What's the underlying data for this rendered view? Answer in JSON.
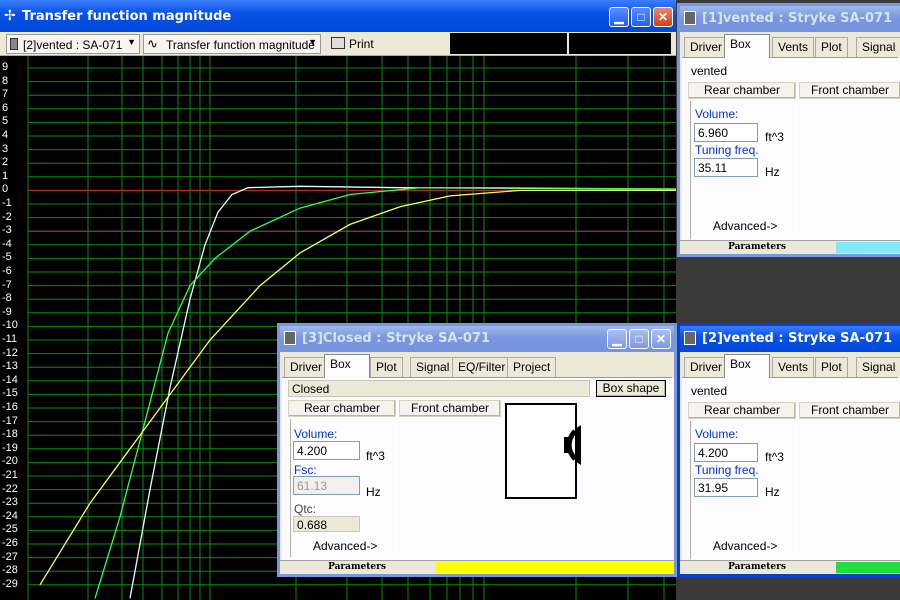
{
  "main_window": {
    "title": "Transfer function magnitude",
    "toolbar": {
      "driver_select": "[2]vented : SA-071",
      "view_select": "Transfer function magnitude",
      "print_label": "Print"
    },
    "y_axis_labels": [
      "9",
      "8",
      "7",
      "6",
      "5",
      "4",
      "3",
      "2",
      "1",
      "0",
      "-1",
      "-2",
      "-3",
      "-4",
      "-5",
      "-6",
      "-7",
      "-8",
      "-9",
      "-10",
      "-11",
      "-12",
      "-13",
      "-14",
      "-15",
      "-16",
      "-17",
      "-18",
      "-19",
      "-20",
      "-21",
      "-22",
      "-23",
      "-24",
      "-25",
      "-26",
      "-27",
      "-28",
      "-29"
    ]
  },
  "window_vented1": {
    "title": "[1]vented : Stryke SA-071",
    "tabs": [
      "Driver",
      "Box",
      "Vents",
      "Plot",
      "Signal"
    ],
    "selected_tab": "Box",
    "box_type": "vented",
    "rear_chamber_label": "Rear chamber",
    "front_chamber_label": "Front chamber",
    "volume_label": "Volume:",
    "volume_value": "6.960",
    "volume_unit": "ft^3",
    "tuning_label": "Tuning freq.",
    "tuning_value": "35.11",
    "tuning_unit": "Hz",
    "advanced_label": "Advanced->",
    "status_label": "Parameters",
    "status_color": "#80e8f8"
  },
  "window_closed3": {
    "title": "[3]Closed : Stryke SA-071",
    "tabs": [
      "Driver",
      "Box",
      "Plot",
      "Signal",
      "EQ/Filter",
      "Project"
    ],
    "selected_tab": "Box",
    "box_type": "Closed",
    "box_shape_label": "Box shape",
    "rear_chamber_label": "Rear chamber",
    "front_chamber_label": "Front chamber",
    "volume_label": "Volume:",
    "volume_value": "4.200",
    "volume_unit": "ft^3",
    "fsc_label": "Fsc:",
    "fsc_value": "61.13",
    "fsc_unit": "Hz",
    "qtc_label": "Qtc:",
    "qtc_value": "0.688",
    "advanced_label": "Advanced->",
    "status_label": "Parameters",
    "status_color": "#ffff00"
  },
  "window_vented2": {
    "title": "[2]vented : Stryke SA-071",
    "tabs": [
      "Driver",
      "Box",
      "Vents",
      "Plot",
      "Signal"
    ],
    "selected_tab": "Box",
    "box_type": "vented",
    "rear_chamber_label": "Rear chamber",
    "front_chamber_label": "Front chamber",
    "volume_label": "Volume:",
    "volume_value": "4.200",
    "volume_unit": "ft^3",
    "tuning_label": "Tuning freq.",
    "tuning_value": "31.95",
    "tuning_unit": "Hz",
    "advanced_label": "Advanced->",
    "status_label": "Parameters",
    "status_color": "#20e040"
  }
}
